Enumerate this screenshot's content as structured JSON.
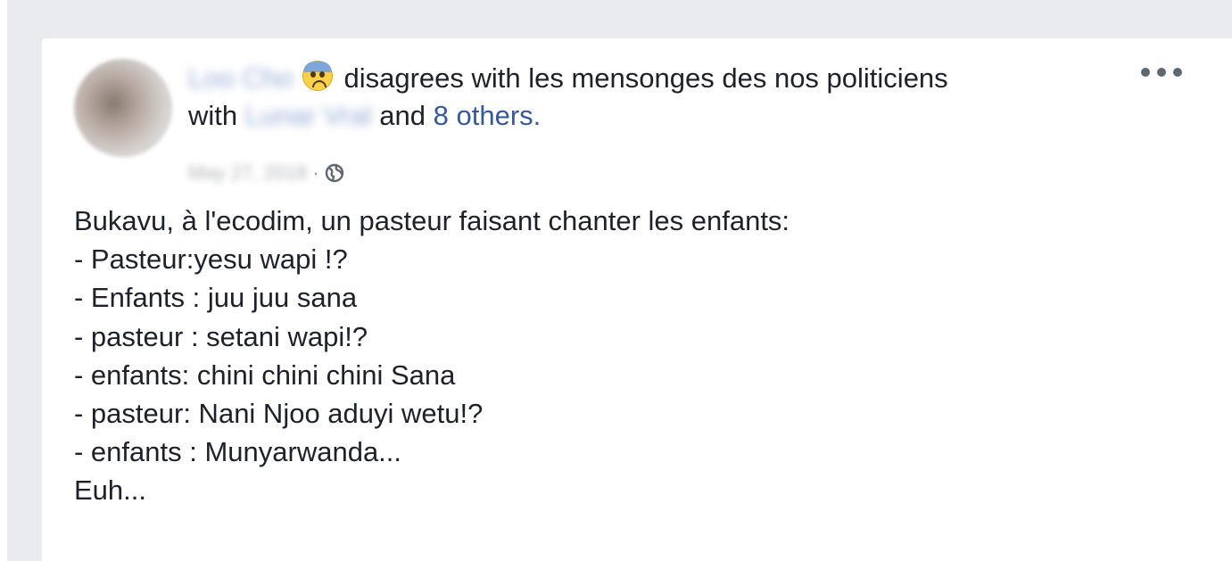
{
  "post": {
    "author_name": "Loo Cho",
    "feeling_text": "disagrees with les mensonges des nos politiciens",
    "with_word": "with",
    "tagged_name": "Lunar Vral",
    "and_word": "and",
    "others_link": "8 others.",
    "date": "May 27, 2018",
    "separator": "·",
    "privacy_icon": "globe-icon",
    "feeling_icon": "fearful-face-emoji",
    "more_icon": "more-options-icon",
    "lines": [
      "Bukavu, à l'ecodim, un pasteur faisant chanter les enfants:",
      "- Pasteur:yesu wapi !?",
      "- Enfants : juu juu sana",
      "- pasteur : setani wapi!?",
      "- enfants: chini chini chini Sana",
      "- pasteur: Nani Njoo aduyi wetu!?",
      "- enfants : Munyarwanda...",
      "Euh..."
    ]
  },
  "colors": {
    "background": "#e9ebee",
    "card": "#ffffff",
    "text": "#1d2129",
    "link": "#385898",
    "meta": "#90949c"
  }
}
